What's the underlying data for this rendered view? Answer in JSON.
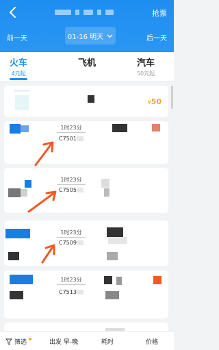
{
  "header": {
    "back_icon": "chevron-left-icon",
    "grab_label": "抢票",
    "prev_day": "前一天",
    "next_day": "后一天",
    "date_label": "01-16 明天",
    "date_icon": "chevron-down-icon",
    "background": "#1e8ef0"
  },
  "tabs": [
    {
      "label": "火车",
      "sub": "4元起",
      "active": true
    },
    {
      "label": "飞机",
      "sub": "",
      "active": false
    },
    {
      "label": "汽车",
      "sub": "50元起",
      "active": false
    }
  ],
  "promo": {
    "price_symbol": "¥",
    "price": "50"
  },
  "trains": [
    {
      "duration": "1时23分",
      "number": "C7501"
    },
    {
      "duration": "1时23分",
      "number": "C7505"
    },
    {
      "duration": "1时23分",
      "number": "C7509"
    },
    {
      "duration": "1时23分",
      "number": "C7513"
    }
  ],
  "bottom_bar": {
    "filter_label": "筛选",
    "filter_icon": "filter-icon",
    "depart_label": "出发 早-晚",
    "duration_label": "耗时",
    "price_label": "价格"
  },
  "colors": {
    "accent": "#1e8ef0",
    "price": "#f5a623",
    "arrow": "#f05a23"
  }
}
